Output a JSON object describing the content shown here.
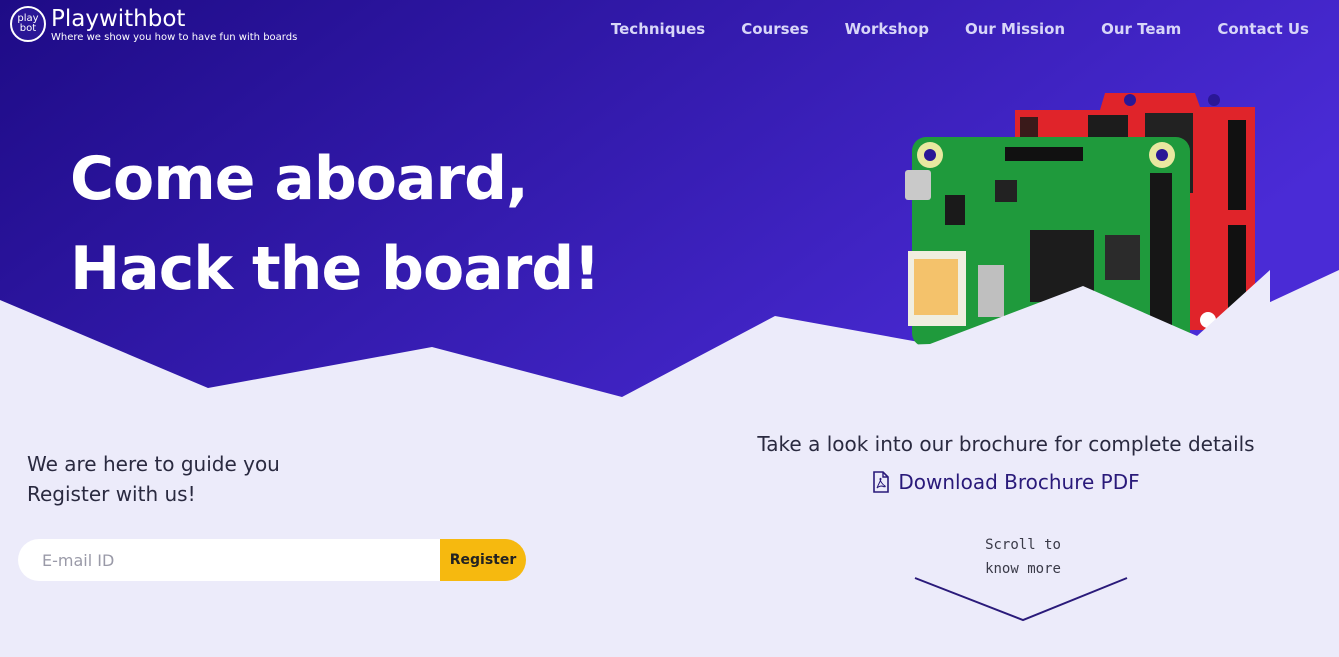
{
  "brand": {
    "badge_top": "play",
    "badge_bottom": "bot",
    "title": "Playwithbot",
    "tagline": "Where we show you how to have fun with boards"
  },
  "nav": {
    "items": [
      {
        "label": "Techniques"
      },
      {
        "label": "Courses"
      },
      {
        "label": "Workshop"
      },
      {
        "label": "Our Mission"
      },
      {
        "label": "Our Team"
      },
      {
        "label": "Contact Us"
      }
    ]
  },
  "hero": {
    "line1": "Come aboard,",
    "line2": "Hack the board!"
  },
  "signup": {
    "line1": "We are here to guide you",
    "line2": "Register with us!",
    "email_placeholder": "E-mail ID",
    "email_value": "",
    "register_label": "Register"
  },
  "brochure": {
    "prompt": "Take a look into our brochure for complete details",
    "download_label": "Download Brochure PDF"
  },
  "scroll": {
    "line1": "Scroll to",
    "line2": "know more"
  },
  "colors": {
    "hero_gradient_start": "#1e0b86",
    "hero_gradient_end": "#4a2bd6",
    "page_background": "#ecebfa",
    "register_button": "#f6b90f",
    "link_color": "#2a1a7a"
  },
  "icons": {
    "pdf": "file-pdf-icon",
    "scroll": "chevron-down-icon"
  }
}
